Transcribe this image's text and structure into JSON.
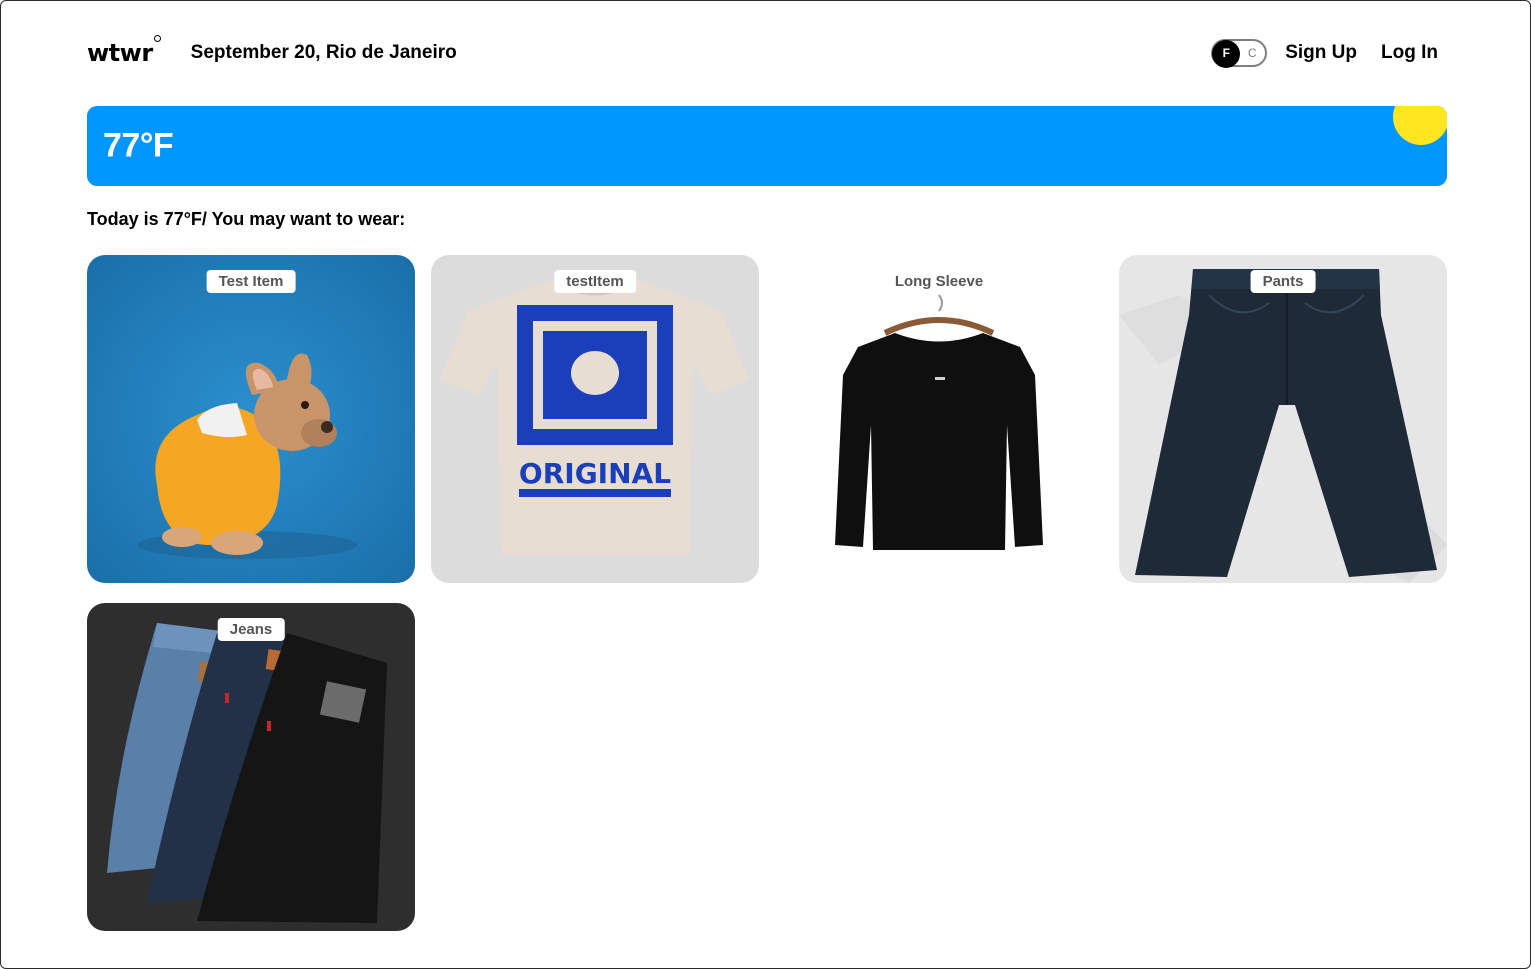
{
  "header": {
    "logo": "wtwr",
    "date_location": "September 20, Rio de Janeiro",
    "toggle": {
      "f": "F",
      "c": "C",
      "selected": "F"
    },
    "signup": "Sign Up",
    "login": "Log In"
  },
  "weather": {
    "temperature": "77°F",
    "banner_color": "#0096ff",
    "sun_color": "#ffe620"
  },
  "recommend_text": "Today is 77°F/ You may want to wear:",
  "items": [
    {
      "label": "Test Item",
      "image": "dog-in-hoodie"
    },
    {
      "label": "testItem",
      "image": "beige-tshirt"
    },
    {
      "label": "Long Sleeve",
      "image": "black-long-sleeve"
    },
    {
      "label": "Pants",
      "image": "dark-pants"
    },
    {
      "label": "Jeans",
      "image": "stacked-jeans"
    }
  ]
}
